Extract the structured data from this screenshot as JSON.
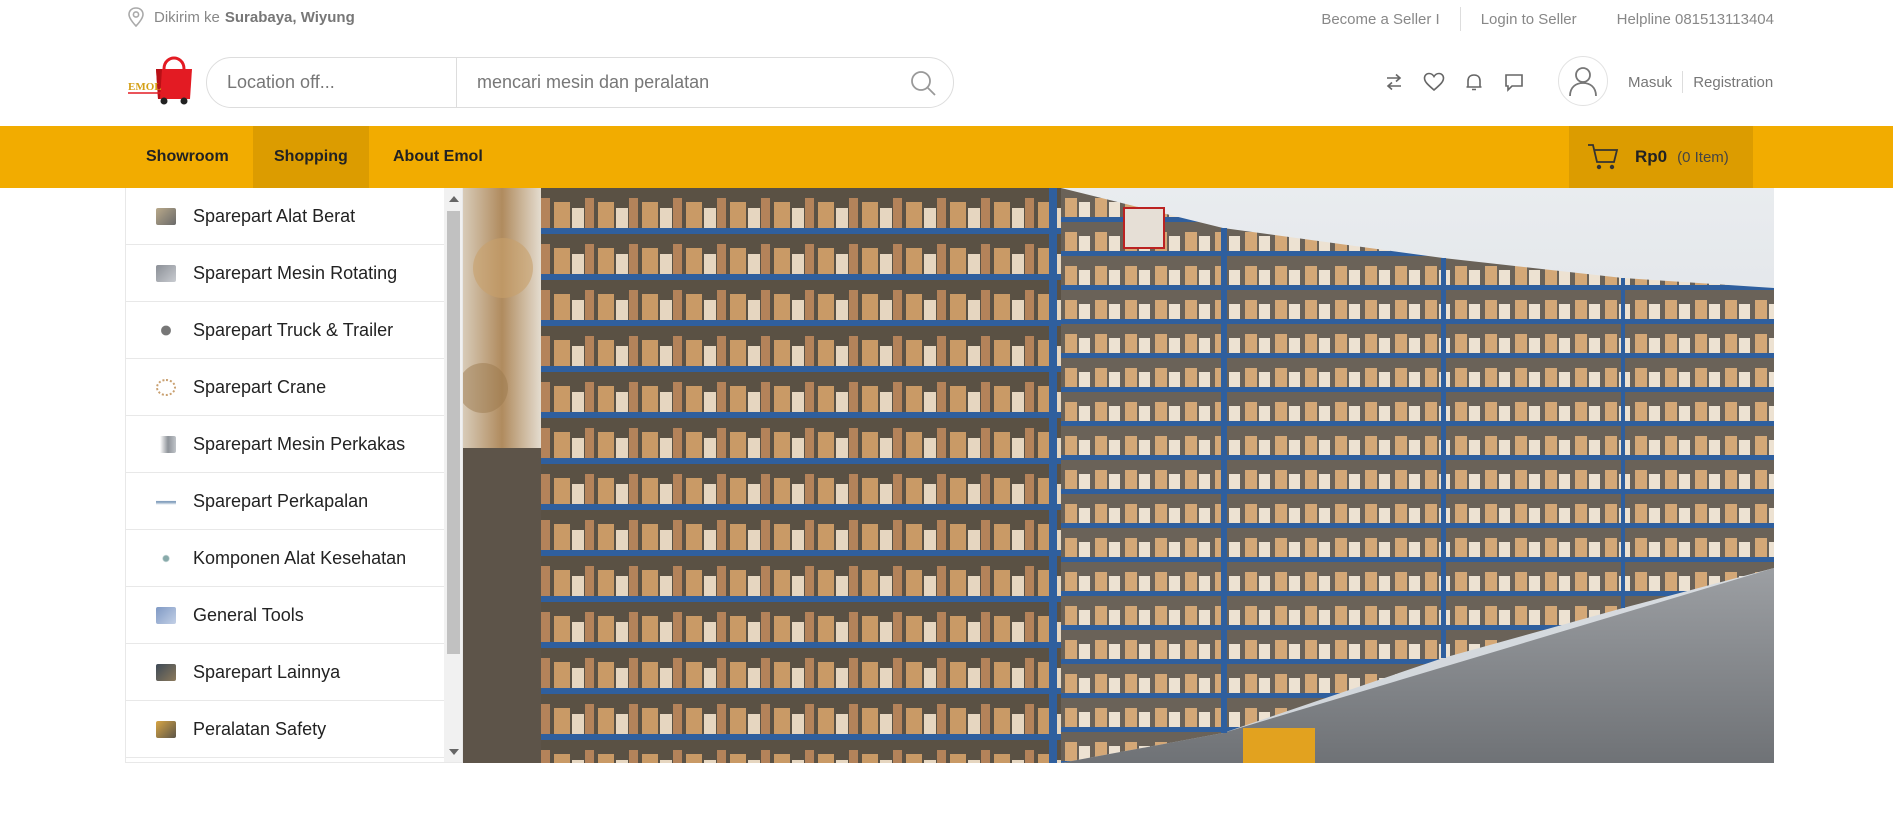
{
  "topbar": {
    "deliver_prefix": "Dikirim ke",
    "deliver_location": "Surabaya, Wiyung",
    "links": [
      "Become a Seller I",
      "Login to Seller"
    ],
    "helpline": "Helpline 081513113404"
  },
  "header": {
    "logo_text": "EMOL",
    "location_value": "Location off...",
    "search_value": "mencari mesin dan peralatan",
    "auth_login": "Masuk",
    "auth_register": "Registration"
  },
  "nav": {
    "items": [
      "Showroom",
      "Shopping",
      "About Emol"
    ],
    "active": "Shopping",
    "cart_amount": "Rp0",
    "cart_count": "(0 Item)"
  },
  "categories": [
    {
      "label": "Sparepart Alat Berat",
      "icon": "heavy-equipment-icon"
    },
    {
      "label": "Sparepart Mesin Rotating",
      "icon": "rotating-machine-icon"
    },
    {
      "label": "Sparepart Truck & Trailer",
      "icon": "truck-icon"
    },
    {
      "label": "Sparepart Crane",
      "icon": "crane-icon"
    },
    {
      "label": "Sparepart Mesin Perkakas",
      "icon": "machine-tool-icon"
    },
    {
      "label": "Sparepart Perkapalan",
      "icon": "ship-icon"
    },
    {
      "label": "Komponen Alat Kesehatan",
      "icon": "medical-icon"
    },
    {
      "label": "General Tools",
      "icon": "tools-icon"
    },
    {
      "label": "Sparepart Lainnya",
      "icon": "misc-parts-icon"
    },
    {
      "label": "Peralatan Safety",
      "icon": "safety-icon"
    }
  ],
  "colors": {
    "nav_bg": "#f2ac00",
    "nav_active": "#dc9c00",
    "shelf_blue": "#2f5f9e",
    "box_brown": "#c99a66"
  }
}
